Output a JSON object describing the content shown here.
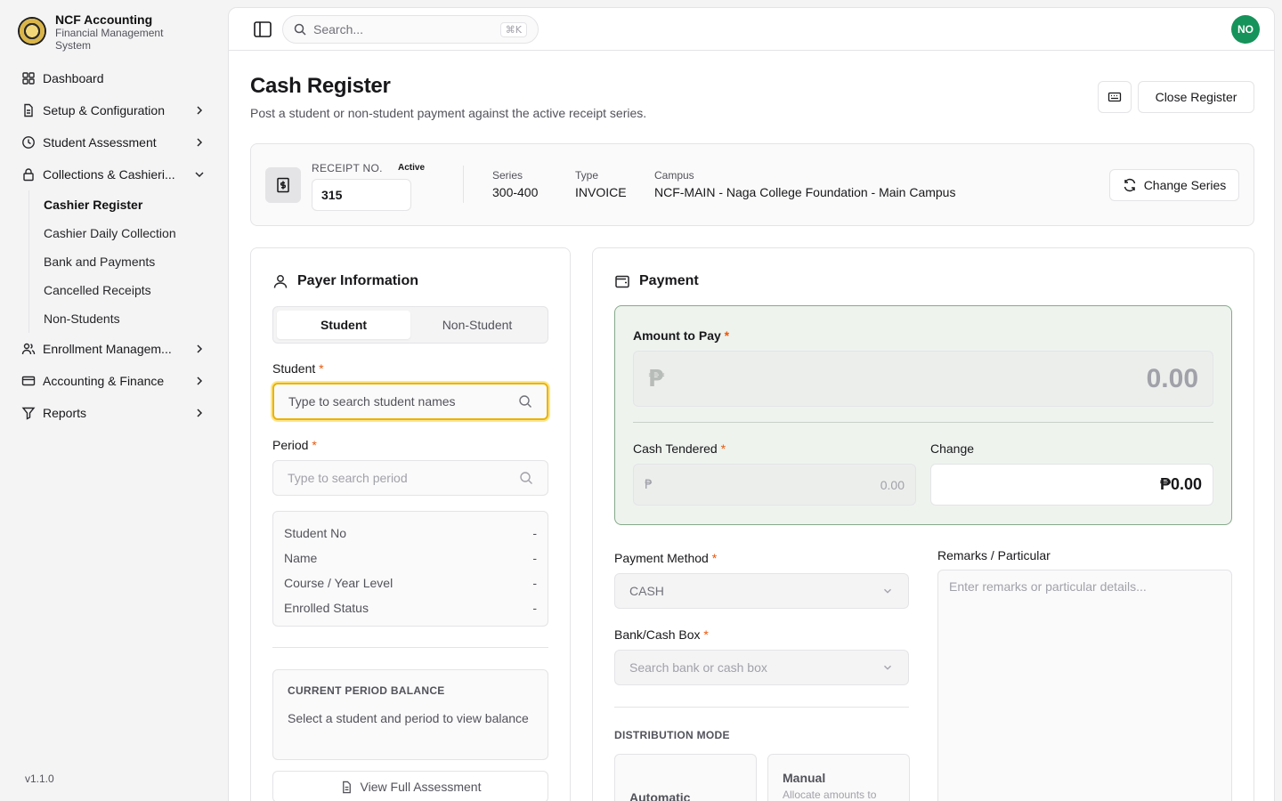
{
  "brand": {
    "title": "NCF Accounting",
    "subtitle": "Financial Management System"
  },
  "sidebar": {
    "items": [
      {
        "label": "Dashboard",
        "icon": "dashboard-icon",
        "has_chevron": false
      },
      {
        "label": "Setup & Configuration",
        "icon": "document-icon",
        "has_chevron": true
      },
      {
        "label": "Student Assessment",
        "icon": "clock-icon",
        "has_chevron": true
      },
      {
        "label": "Collections & Cashieri...",
        "icon": "lock-icon",
        "has_chevron": true,
        "expanded": true
      },
      {
        "label": "Enrollment Managem...",
        "icon": "users-icon",
        "has_chevron": true
      },
      {
        "label": "Accounting & Finance",
        "icon": "card-icon",
        "has_chevron": true
      },
      {
        "label": "Reports",
        "icon": "filter-icon",
        "has_chevron": true
      }
    ],
    "sub_items": [
      {
        "label": "Cashier Register",
        "active": true
      },
      {
        "label": "Cashier Daily Collection",
        "active": false
      },
      {
        "label": "Bank and Payments",
        "active": false
      },
      {
        "label": "Cancelled Receipts",
        "active": false
      },
      {
        "label": "Non-Students",
        "active": false
      }
    ],
    "version": "v1.1.0"
  },
  "topbar": {
    "search_placeholder": "Search...",
    "shortcut": "⌘K",
    "avatar_initials": "NO"
  },
  "page": {
    "title": "Cash Register",
    "description": "Post a student or non-student payment against the active receipt series.",
    "close_register_label": "Close Register"
  },
  "receipt": {
    "label": "RECEIPT NO.",
    "status": "Active",
    "number": "315",
    "series_label": "Series",
    "series_value": "300-400",
    "type_label": "Type",
    "type_value": "INVOICE",
    "campus_label": "Campus",
    "campus_value": "NCF-MAIN - Naga College Foundation - Main Campus",
    "change_series_label": "Change Series"
  },
  "payer": {
    "title": "Payer Information",
    "tabs": [
      "Student",
      "Non-Student"
    ],
    "active_tab": 0,
    "student_label": "Student",
    "student_placeholder": "Type to search student names",
    "period_label": "Period",
    "period_placeholder": "Type to search period",
    "required_mark": "*",
    "info_rows": [
      {
        "label": "Student No",
        "value": "-"
      },
      {
        "label": "Name",
        "value": "-"
      },
      {
        "label": "Course / Year Level",
        "value": "-"
      },
      {
        "label": "Enrolled Status",
        "value": "-"
      }
    ],
    "balance_title": "CURRENT PERIOD BALANCE",
    "balance_text": "Select a student and period to view balance",
    "view_assessment_label": "View Full Assessment"
  },
  "payment": {
    "title": "Payment",
    "amount_label": "Amount to Pay",
    "currency_symbol": "₱",
    "amount_value": "0.00",
    "cash_tendered_label": "Cash Tendered",
    "cash_tendered_value": "0.00",
    "change_label": "Change",
    "change_value": "₱0.00",
    "method_label": "Payment Method",
    "method_value": "CASH",
    "bank_label": "Bank/Cash Box",
    "bank_placeholder": "Search bank or cash box",
    "remarks_label": "Remarks / Particular",
    "remarks_placeholder": "Enter remarks or particular details...",
    "distribution_title": "DISTRIBUTION MODE",
    "modes": [
      {
        "title": "Automatic",
        "desc": ""
      },
      {
        "title": "Manual",
        "desc": "Allocate amounts to"
      }
    ]
  },
  "colors": {
    "accent_green": "#15935a",
    "focus_ring": "#eab308",
    "required": "#ea580c",
    "amount_panel_bg": "#eef3ee"
  }
}
